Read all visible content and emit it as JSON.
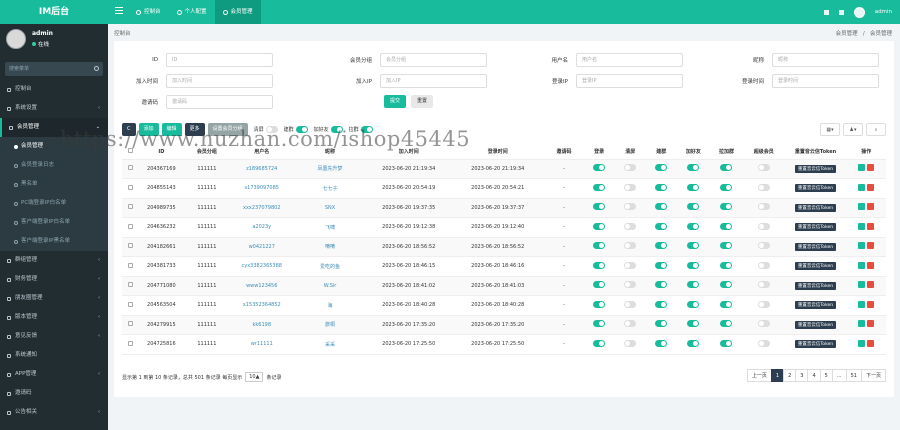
{
  "app_title": "IM后台",
  "header": {
    "tabs": [
      {
        "label": "控制台"
      },
      {
        "label": "个人配置"
      },
      {
        "label": "会员管理"
      }
    ],
    "user": "admin"
  },
  "sidebar": {
    "user": {
      "name": "admin",
      "status": "在线"
    },
    "search_placeholder": "搜索菜单",
    "items": [
      {
        "label": "控制台"
      },
      {
        "label": "系统设置"
      },
      {
        "label": "会员管理"
      },
      {
        "label": "群组管理"
      },
      {
        "label": "财务管理"
      },
      {
        "label": "朋友圈管理"
      },
      {
        "label": "版本管理"
      },
      {
        "label": "意见反馈"
      },
      {
        "label": "系统通知"
      },
      {
        "label": "APP管理"
      },
      {
        "label": "邀请码"
      },
      {
        "label": "公告相关"
      }
    ],
    "subitems": [
      {
        "label": "会员管理"
      },
      {
        "label": "会员登录日志"
      },
      {
        "label": "黑名单"
      },
      {
        "label": "PC端登录IP白名单"
      },
      {
        "label": "客户端登录IP白名单"
      },
      {
        "label": "客户端登录IP黑名单"
      }
    ]
  },
  "breadcrumb": {
    "left": "控制台",
    "right_1": "会员管理",
    "right_2": "会员管理"
  },
  "filter": {
    "fields": [
      {
        "label": "ID",
        "placeholder": "ID"
      },
      {
        "label": "会员分组",
        "placeholder": "会员分组"
      },
      {
        "label": "用户名",
        "placeholder": "用户名"
      },
      {
        "label": "昵称",
        "placeholder": "昵称"
      },
      {
        "label": "加入时间",
        "placeholder": "加入时间"
      },
      {
        "label": "加入IP",
        "placeholder": "加入IP"
      },
      {
        "label": "登录IP",
        "placeholder": "登录IP"
      },
      {
        "label": "登录时间",
        "placeholder": "登录时间"
      },
      {
        "label": "邀请码",
        "placeholder": "邀请码"
      }
    ],
    "submit": "提交",
    "reset": "重置"
  },
  "toolbar": {
    "refresh": "C",
    "add": "添加",
    "edit": "编辑",
    "more": "更多",
    "batch": "设置会员分组",
    "switches": [
      {
        "label": "清屏",
        "on": false
      },
      {
        "label": "建群",
        "on": true
      },
      {
        "label": "加好友",
        "on": true
      },
      {
        "label": "拉群",
        "on": true
      }
    ]
  },
  "table": {
    "columns": [
      "ID",
      "会员分组",
      "用户名",
      "昵称",
      "加入时间",
      "登录时间",
      "邀请码",
      "登录",
      "清屏",
      "建群",
      "加好友",
      "拉加群",
      "超级会员",
      "重置音云信Token",
      "操作"
    ],
    "token_label": "重置音云信Token",
    "rows": [
      {
        "id": "204367169",
        "group": "111111",
        "username": "z189685724",
        "nick": "凤凰先升梦",
        "join": "2023-06-20 21:19:34",
        "login": "2023-06-20 21:19:34",
        "code": "-",
        "s": [
          true,
          false,
          true,
          true,
          true,
          false
        ]
      },
      {
        "id": "204855143",
        "group": "111111",
        "username": "s1739097085",
        "nick": "七七子",
        "join": "2023-06-20 20:54:19",
        "login": "2023-06-20 20:54:21",
        "code": "-",
        "s": [
          true,
          false,
          true,
          true,
          true,
          false
        ]
      },
      {
        "id": "204989735",
        "group": "111111",
        "username": "xxx237079802",
        "nick": "SNX",
        "join": "2023-06-20 19:37:35",
        "login": "2023-06-20 19:37:37",
        "code": "-",
        "s": [
          true,
          false,
          true,
          true,
          true,
          false
        ]
      },
      {
        "id": "204636232",
        "group": "111111",
        "username": "a2023y",
        "nick": "飞啸",
        "join": "2023-06-20 19:12:38",
        "login": "2023-06-20 19:12:40",
        "code": "-",
        "s": [
          true,
          false,
          true,
          true,
          true,
          false
        ]
      },
      {
        "id": "204182661",
        "group": "111111",
        "username": "w0421227",
        "nick": "嘀嘀",
        "join": "2023-06-20 18:56:52",
        "login": "2023-06-20 18:56:52",
        "code": "-",
        "s": [
          true,
          false,
          true,
          true,
          true,
          false
        ]
      },
      {
        "id": "204381733",
        "group": "111111",
        "username": "cyx3382365388",
        "nick": "爱吃的鱼",
        "join": "2023-06-20 18:46:15",
        "login": "2023-06-20 18:46:16",
        "code": "-",
        "s": [
          true,
          false,
          true,
          true,
          true,
          false
        ]
      },
      {
        "id": "204771080",
        "group": "111111",
        "username": "www123456",
        "nick": "W.Sir",
        "join": "2023-06-20 18:41:02",
        "login": "2023-06-20 18:41:03",
        "code": "-",
        "s": [
          true,
          false,
          true,
          true,
          true,
          false
        ]
      },
      {
        "id": "204563504",
        "group": "111111",
        "username": "x15352364852",
        "nick": "海",
        "join": "2023-06-20 18:40:28",
        "login": "2023-06-20 18:40:28",
        "code": "-",
        "s": [
          true,
          false,
          true,
          true,
          true,
          false
        ]
      },
      {
        "id": "204279915",
        "group": "111111",
        "username": "kk6198",
        "nick": "旅桐",
        "join": "2023-06-20 17:35:20",
        "login": "2023-06-20 17:35:20",
        "code": "-",
        "s": [
          true,
          false,
          true,
          true,
          true,
          false
        ]
      },
      {
        "id": "204725816",
        "group": "111111",
        "username": "wr11111",
        "nick": "采采",
        "join": "2023-06-20 17:25:50",
        "login": "2023-06-20 17:25:50",
        "code": "-",
        "s": [
          true,
          false,
          true,
          true,
          true,
          false
        ]
      }
    ]
  },
  "footer": {
    "summary": "显示第 1 到第 10 条记录，总共 501 条记录 每页显示",
    "page_size": "10▲",
    "suffix": "条记录"
  },
  "pager": {
    "prev": "上一页",
    "pages": [
      "1",
      "2",
      "3",
      "4",
      "5",
      "...",
      "51"
    ],
    "next": "下一页"
  },
  "watermark": "https://www.huzhan.com/ishop45445"
}
